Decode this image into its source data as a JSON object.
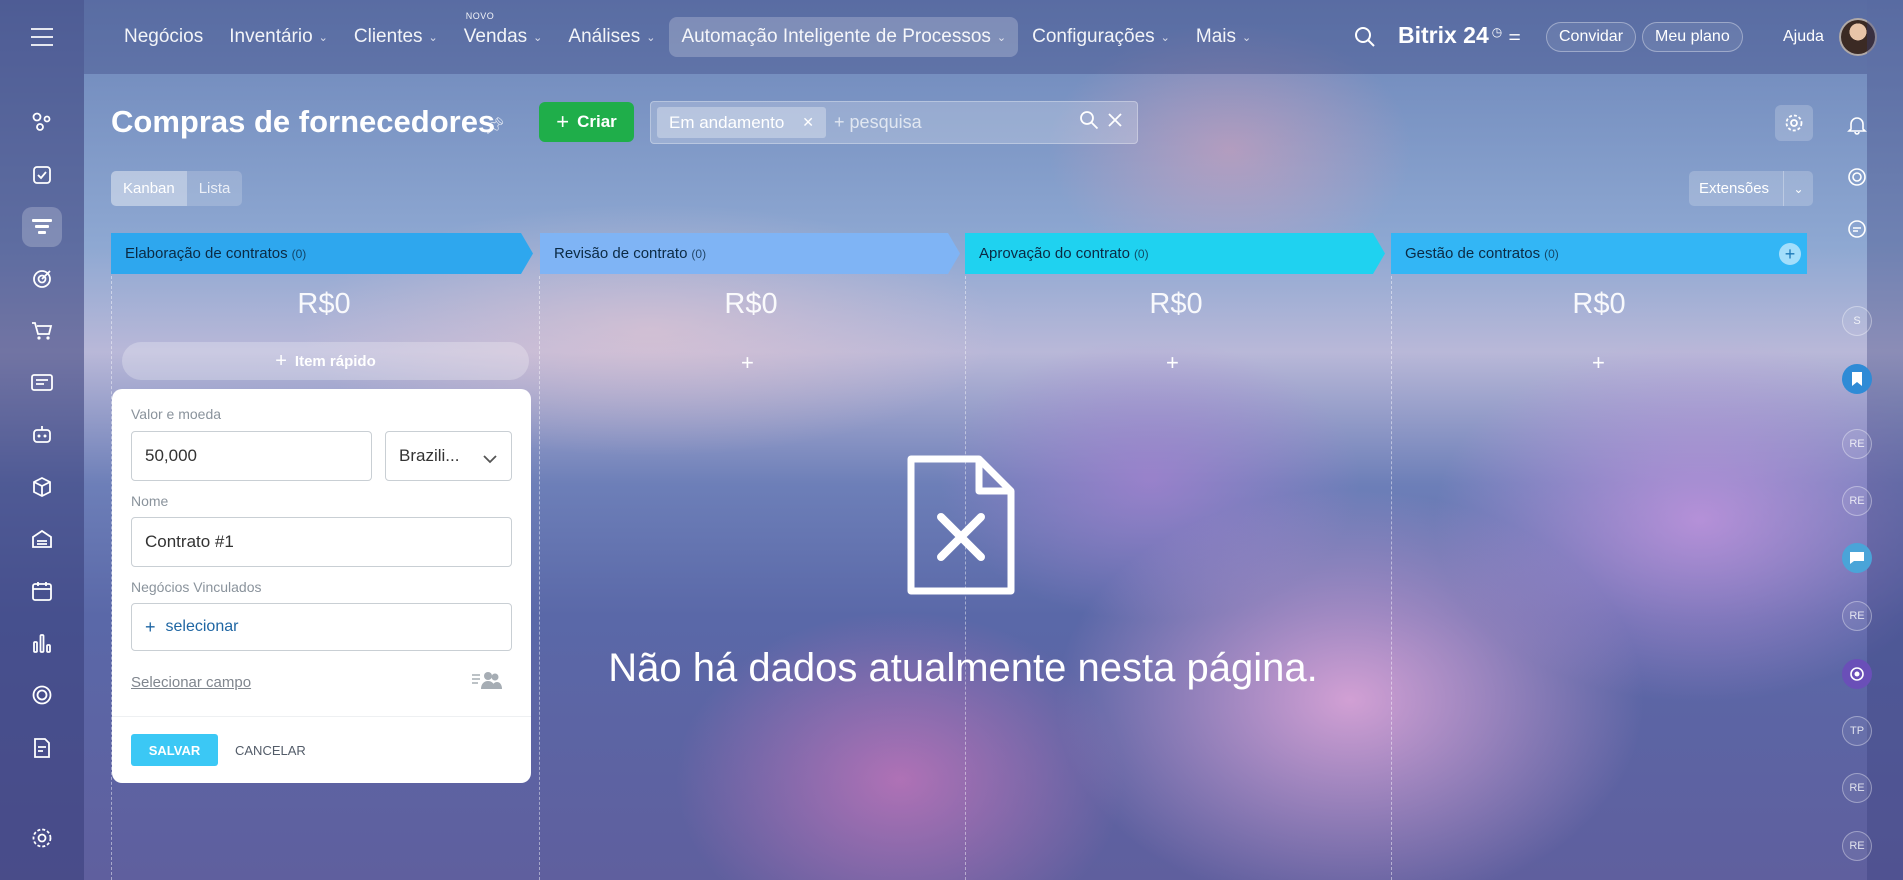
{
  "topnav": {
    "items": [
      {
        "label": "Negócios",
        "badge": "",
        "dropdown": false
      },
      {
        "label": "Inventário",
        "badge": "",
        "dropdown": true
      },
      {
        "label": "Clientes",
        "badge": "",
        "dropdown": true
      },
      {
        "label": "Vendas",
        "badge": "NOVO",
        "dropdown": true
      },
      {
        "label": "Análises",
        "badge": "",
        "dropdown": true
      },
      {
        "label": "Automação Inteligente de Processos",
        "badge": "",
        "dropdown": true
      },
      {
        "label": "Configurações",
        "badge": "",
        "dropdown": true
      },
      {
        "label": "Mais",
        "badge": "",
        "dropdown": true
      }
    ],
    "brand": "Bitrix 24",
    "invite_label": "Convidar",
    "plan_label": "Meu plano",
    "help_label": "Ajuda"
  },
  "page": {
    "title": "Compras de fornecedores",
    "create_label": "Criar",
    "filter_chip": "Em andamento",
    "search_placeholder": "+ pesquisa",
    "view_kanban": "Kanban",
    "view_list": "Lista",
    "extensions_label": "Extensões"
  },
  "columns": [
    {
      "name": "Elaboração de contratos",
      "count": "(0)",
      "sum": "R$0",
      "color": "#2ea7ee"
    },
    {
      "name": "Revisão de contrato",
      "count": "(0)",
      "sum": "R$0",
      "color": "#7fb4f5"
    },
    {
      "name": "Aprovação do contrato",
      "count": "(0)",
      "sum": "R$0",
      "color": "#1fd2f0"
    },
    {
      "name": "Gestão de contratos",
      "count": "(0)",
      "sum": "R$0",
      "color": "#33b6f5"
    }
  ],
  "quick_item": {
    "label": "Item rápido"
  },
  "quick_form": {
    "amount_label": "Valor e moeda",
    "amount_value": "50,000",
    "currency_value": "Brazili...",
    "name_label": "Nome",
    "name_value": "Contrato #1",
    "linked_label": "Negócios Vinculados",
    "linked_action": "selecionar",
    "select_field": "Selecionar campo",
    "save_label": "SALVAR",
    "cancel_label": "CANCELAR"
  },
  "empty_state": {
    "text": "Não há dados atualmente nesta página."
  },
  "right_rail": {
    "avatars": [
      "S",
      "RE",
      "RE",
      "RE",
      "TP",
      "RE",
      "RE"
    ]
  }
}
